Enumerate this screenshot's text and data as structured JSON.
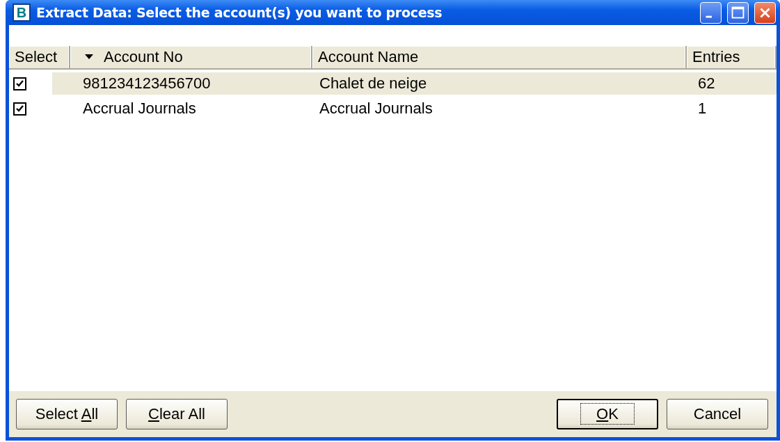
{
  "window": {
    "icon_letter": "B",
    "title": "Extract Data: Select the account(s) you want to process"
  },
  "table": {
    "columns": [
      {
        "label": "Select",
        "sorted": false
      },
      {
        "label": "Account No",
        "sorted": true
      },
      {
        "label": "Account Name",
        "sorted": false
      },
      {
        "label": "Entries",
        "sorted": false
      }
    ],
    "rows": [
      {
        "checked": true,
        "selected": true,
        "cells": [
          "",
          "981234123456700",
          "Chalet de neige",
          "62"
        ]
      },
      {
        "checked": true,
        "selected": false,
        "cells": [
          "",
          "Accrual Journals",
          "Accrual Journals",
          "1"
        ]
      }
    ]
  },
  "buttons_left": [
    {
      "kind": "underline-last-word",
      "label": "Select All",
      "default": false
    },
    {
      "kind": "underline-first-word",
      "label": "Clear All",
      "default": false
    }
  ],
  "buttons_right": [
    {
      "kind": "underline-first-word",
      "label": "OK",
      "default": true
    },
    {
      "kind": "plain",
      "label": "Cancel",
      "default": false
    }
  ]
}
